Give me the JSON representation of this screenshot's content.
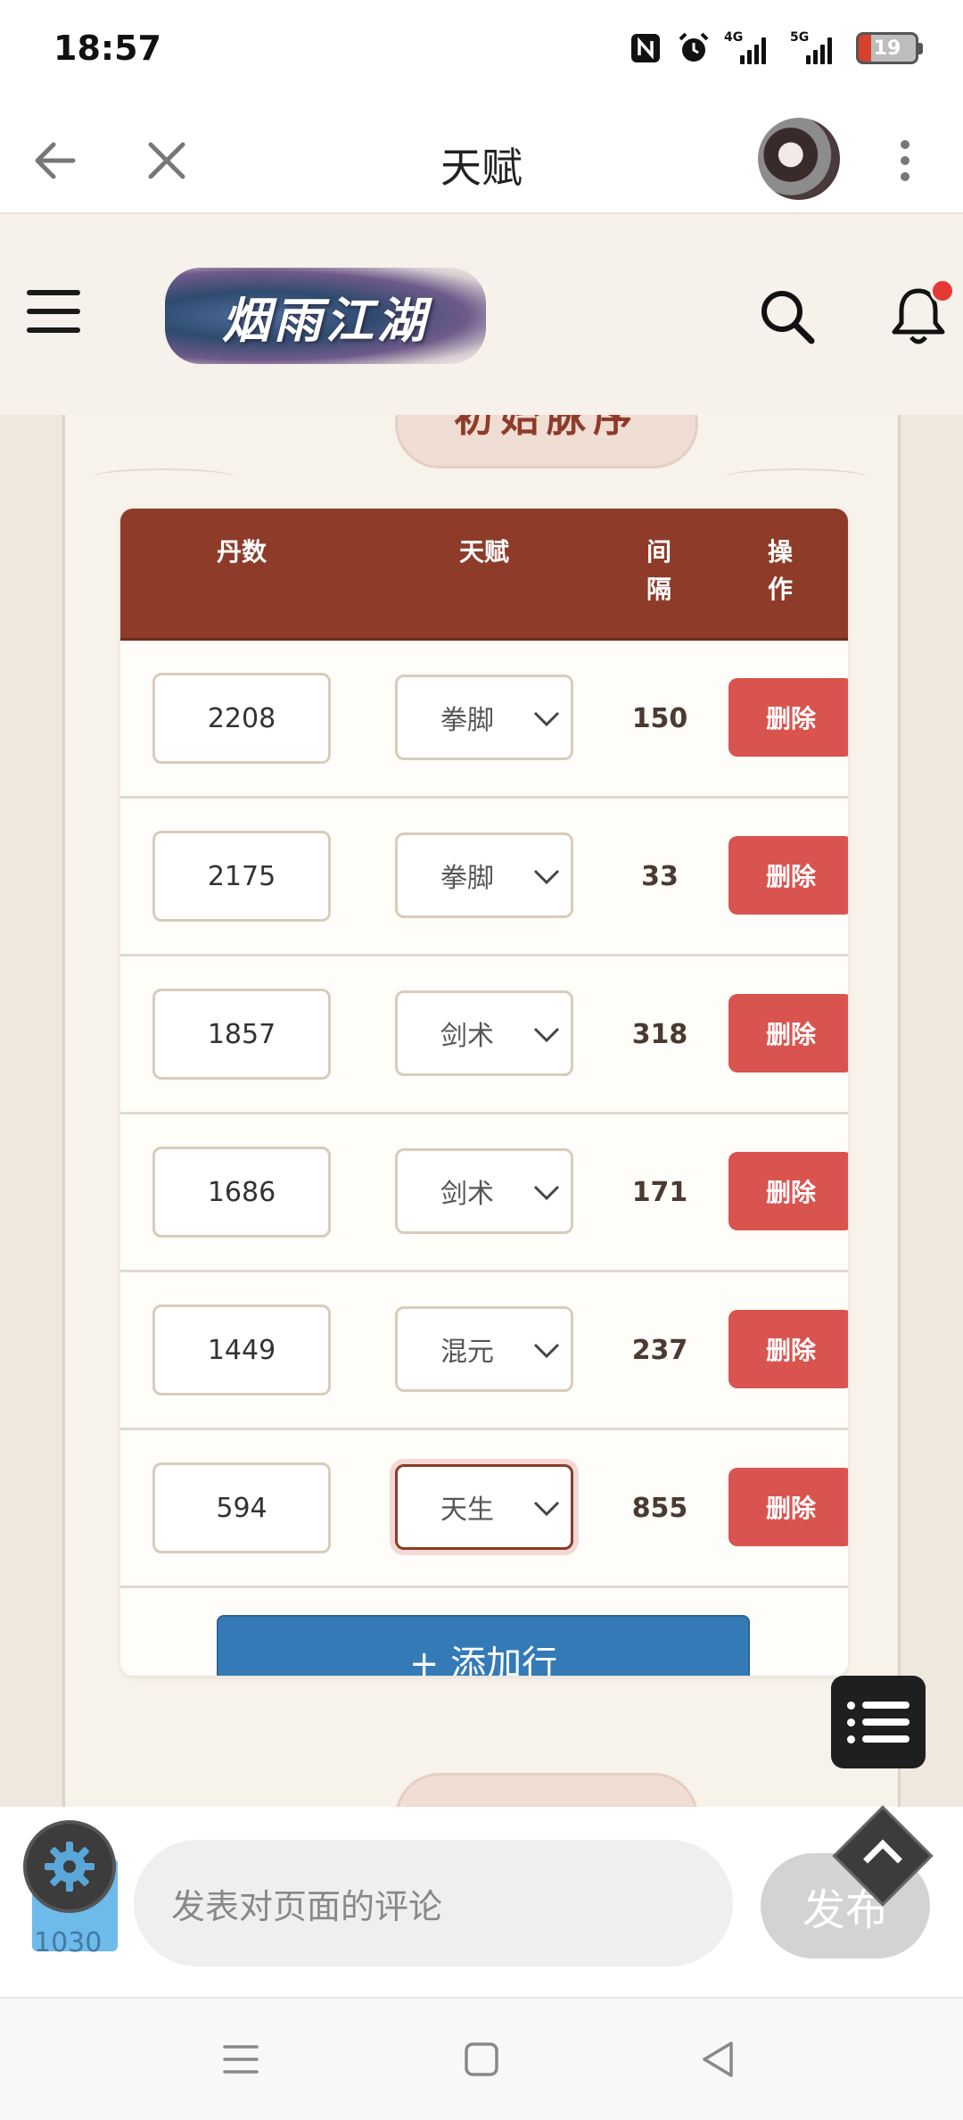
{
  "status": {
    "time": "18:57",
    "net1": "4G",
    "net2": "5G",
    "battery": "19"
  },
  "appbar": {
    "title": "天赋"
  },
  "site": {
    "logo_text": "烟雨江湖"
  },
  "section": {
    "title": "初始脉序"
  },
  "table": {
    "headers": {
      "dan": "丹数",
      "talent": "天赋",
      "interval": "间\n隔",
      "action": "操\n作"
    },
    "rows": [
      {
        "dan": "2208",
        "talent": "拳脚",
        "interval": "150",
        "action": "删除"
      },
      {
        "dan": "2175",
        "talent": "拳脚",
        "interval": "33",
        "action": "删除"
      },
      {
        "dan": "1857",
        "talent": "剑术",
        "interval": "318",
        "action": "删除"
      },
      {
        "dan": "1686",
        "talent": "剑术",
        "interval": "171",
        "action": "删除"
      },
      {
        "dan": "1449",
        "talent": "混元",
        "interval": "237",
        "action": "删除"
      },
      {
        "dan": "594",
        "talent": "天生",
        "interval": "855",
        "action": "删除"
      }
    ],
    "add_label": "+ 添加行"
  },
  "comment": {
    "placeholder": "发表对页面的评论",
    "publish": "发布",
    "badge_count": "1030"
  },
  "colors": {
    "header_red": "#8e3b2a",
    "delete_red": "#d9534f",
    "add_blue": "#337ab7"
  }
}
